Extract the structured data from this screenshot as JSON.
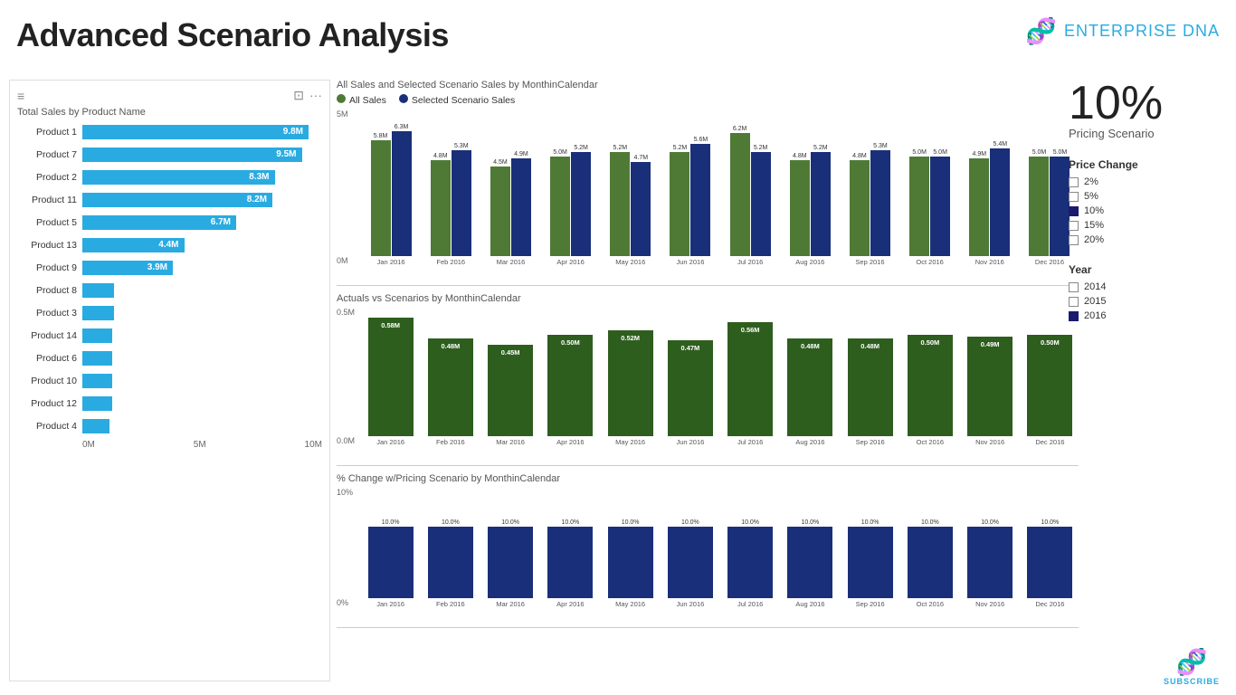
{
  "title": "Advanced Scenario Analysis",
  "logo": {
    "text_bold": "ENTERPRISE",
    "text_light": "DNA",
    "subscribe": "SUBSCRIBE"
  },
  "left_panel": {
    "title": "Total Sales by Product Name",
    "products": [
      {
        "name": "Product 1",
        "value": "9.8M",
        "pct": 100
      },
      {
        "name": "Product 7",
        "value": "9.5M",
        "pct": 97
      },
      {
        "name": "Product 2",
        "value": "8.3M",
        "pct": 85
      },
      {
        "name": "Product 11",
        "value": "8.2M",
        "pct": 84
      },
      {
        "name": "Product 5",
        "value": "6.7M",
        "pct": 68
      },
      {
        "name": "Product 13",
        "value": "4.4M",
        "pct": 45
      },
      {
        "name": "Product 9",
        "value": "3.9M",
        "pct": 40
      },
      {
        "name": "Product 8",
        "value": "1.4M",
        "pct": 14
      },
      {
        "name": "Product 3",
        "value": "1.4M",
        "pct": 14
      },
      {
        "name": "Product 14",
        "value": "1.3M",
        "pct": 13
      },
      {
        "name": "Product 6",
        "value": "1.3M",
        "pct": 13
      },
      {
        "name": "Product 10",
        "value": "1.3M",
        "pct": 13
      },
      {
        "name": "Product 12",
        "value": "1.3M",
        "pct": 13
      },
      {
        "name": "Product 4",
        "value": "1.2M",
        "pct": 12
      }
    ],
    "axis": [
      "0M",
      "5M",
      "10M"
    ]
  },
  "chart1": {
    "title": "All Sales and Selected Scenario Sales by MonthinCalendar",
    "legend": [
      {
        "label": "All Sales",
        "color": "#4e7a36"
      },
      {
        "label": "Selected Scenario Sales",
        "color": "#1a2f7a"
      }
    ],
    "y_labels": [
      "5M",
      "0M"
    ],
    "months": [
      {
        "label": "Jan 2016",
        "green": "5.8M",
        "blue": "6.3M",
        "gh": 128,
        "bh": 138
      },
      {
        "label": "Feb 2016",
        "green": "4.8M",
        "blue": "5.3M",
        "gh": 106,
        "bh": 117
      },
      {
        "label": "Mar 2016",
        "green": "4.5M",
        "blue": "4.9M",
        "gh": 99,
        "bh": 108
      },
      {
        "label": "Apr 2016",
        "green": "5.0M",
        "blue": "5.2M",
        "gh": 110,
        "bh": 115
      },
      {
        "label": "May 2016",
        "green": "5.2M",
        "blue": "4.7M",
        "gh": 115,
        "bh": 104
      },
      {
        "label": "Jun 2016",
        "green": "5.2M",
        "blue": "5.6M",
        "gh": 115,
        "bh": 124
      },
      {
        "label": "Jul 2016",
        "green": "6.2M",
        "blue": "5.2M",
        "gh": 136,
        "bh": 115
      },
      {
        "label": "Aug 2016",
        "green": "4.8M",
        "blue": "5.2M",
        "gh": 106,
        "bh": 115
      },
      {
        "label": "Sep 2016",
        "green": "4.8M",
        "blue": "5.3M",
        "gh": 106,
        "bh": 117
      },
      {
        "label": "Oct 2016",
        "green": "5.0M",
        "blue": "5.0M",
        "gh": 110,
        "bh": 110
      },
      {
        "label": "Nov 2016",
        "green": "4.9M",
        "blue": "5.4M",
        "gh": 108,
        "bh": 119
      },
      {
        "label": "Dec 2016",
        "green": "5.0M",
        "blue": "5.0M",
        "gh": 110,
        "bh": 110
      }
    ]
  },
  "chart2": {
    "title": "Actuals vs Scenarios by MonthinCalendar",
    "y_labels": [
      "0.5M",
      "0.0M"
    ],
    "months": [
      {
        "label": "Jan 2016",
        "val": "0.58M",
        "h": 140
      },
      {
        "label": "Feb 2016",
        "val": "0.48M",
        "h": 115
      },
      {
        "label": "Mar 2016",
        "val": "0.45M",
        "h": 108
      },
      {
        "label": "Apr 2016",
        "val": "0.50M",
        "h": 120
      },
      {
        "label": "May 2016",
        "val": "0.52M",
        "h": 125
      },
      {
        "label": "Jun 2016",
        "val": "0.47M",
        "h": 113
      },
      {
        "label": "Jul 2016",
        "val": "0.56M",
        "h": 135
      },
      {
        "label": "Aug 2016",
        "val": "0.48M",
        "h": 115
      },
      {
        "label": "Sep 2016",
        "val": "0.48M",
        "h": 115
      },
      {
        "label": "Oct 2016",
        "val": "0.50M",
        "h": 120
      },
      {
        "label": "Nov 2016",
        "val": "0.49M",
        "h": 118
      },
      {
        "label": "Dec 2016",
        "val": "0.50M",
        "h": 120
      }
    ]
  },
  "chart3": {
    "title": "% Change w/Pricing Scenario by MonthinCalendar",
    "y_labels": [
      "10%",
      "0%"
    ],
    "months": [
      {
        "label": "Jan 2016",
        "val": "10.0%",
        "h": 100
      },
      {
        "label": "Feb 2016",
        "val": "10.0%",
        "h": 100
      },
      {
        "label": "Mar 2016",
        "val": "10.0%",
        "h": 100
      },
      {
        "label": "Apr 2016",
        "val": "10.0%",
        "h": 100
      },
      {
        "label": "May 2016",
        "val": "10.0%",
        "h": 100
      },
      {
        "label": "Jun 2016",
        "val": "10.0%",
        "h": 100
      },
      {
        "label": "Jul 2016",
        "val": "10.0%",
        "h": 100
      },
      {
        "label": "Aug 2016",
        "val": "10.0%",
        "h": 100
      },
      {
        "label": "Sep 2016",
        "val": "10.0%",
        "h": 100
      },
      {
        "label": "Oct 2016",
        "val": "10.0%",
        "h": 100
      },
      {
        "label": "Nov 2016",
        "val": "10.0%",
        "h": 100
      },
      {
        "label": "Dec 2016",
        "val": "10.0%",
        "h": 100
      }
    ]
  },
  "right_panel": {
    "pricing_value": "10%",
    "pricing_label": "Pricing Scenario",
    "price_change": {
      "title": "Price Change",
      "options": [
        {
          "label": "2%",
          "checked": false
        },
        {
          "label": "5%",
          "checked": false
        },
        {
          "label": "10%",
          "checked": true
        },
        {
          "label": "15%",
          "checked": false
        },
        {
          "label": "20%",
          "checked": false
        }
      ]
    },
    "year": {
      "title": "Year",
      "options": [
        {
          "label": "2014",
          "checked": false
        },
        {
          "label": "2015",
          "checked": false
        },
        {
          "label": "2016",
          "checked": true
        }
      ]
    }
  }
}
